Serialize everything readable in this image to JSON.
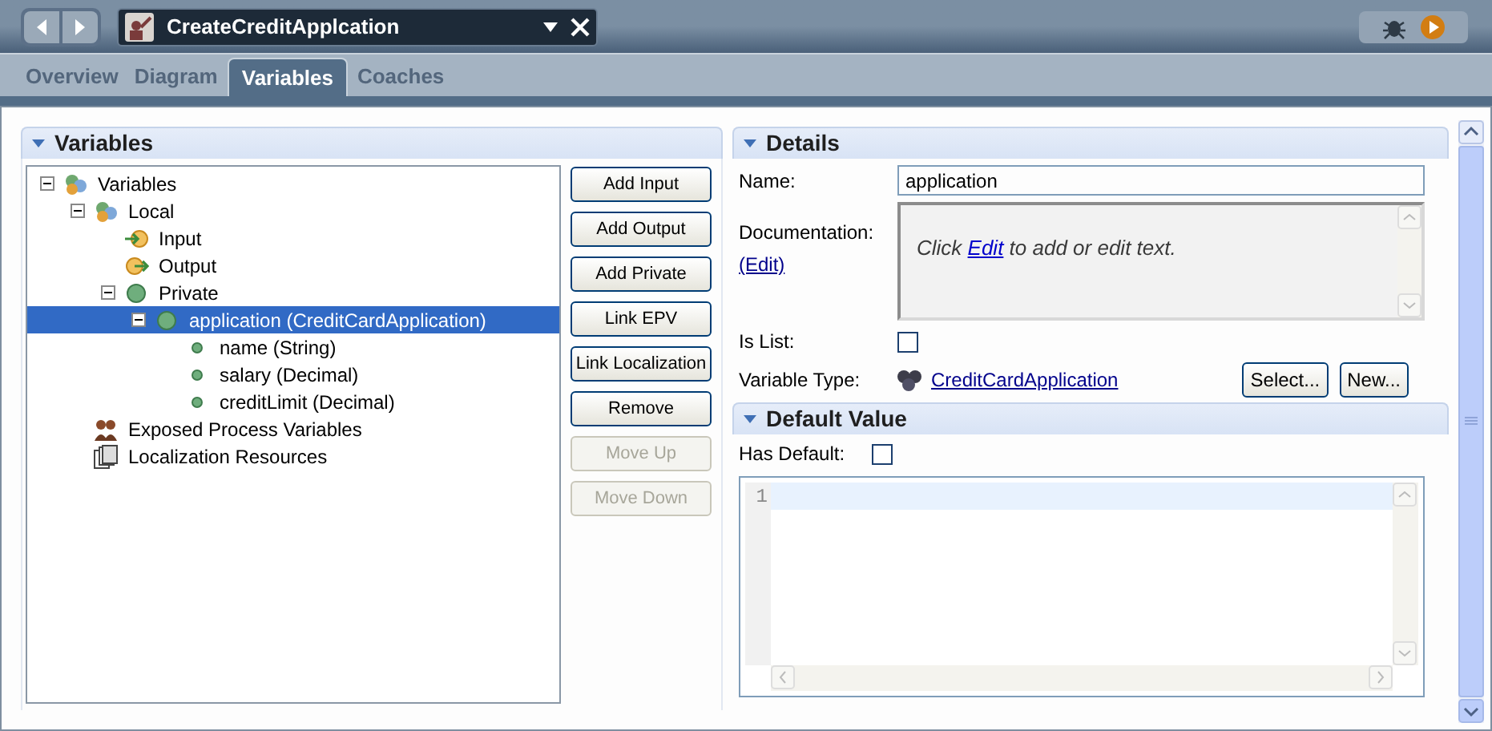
{
  "editor_tab": {
    "title": "CreateCreditApplcation"
  },
  "tabs": [
    {
      "label": "Overview",
      "selected": false
    },
    {
      "label": "Diagram",
      "selected": false
    },
    {
      "label": "Variables",
      "selected": true
    },
    {
      "label": "Coaches",
      "selected": false
    }
  ],
  "variables_panel": {
    "title": "Variables",
    "tree": [
      {
        "label": "Variables",
        "kind": "group",
        "expanded": true,
        "selected": false,
        "children": [
          {
            "label": "Local",
            "kind": "group",
            "expanded": true,
            "selected": false,
            "children": [
              {
                "label": "Input",
                "kind": "input",
                "selected": false
              },
              {
                "label": "Output",
                "kind": "output",
                "selected": false
              },
              {
                "label": "Private",
                "kind": "private",
                "expanded": true,
                "selected": false,
                "children": [
                  {
                    "label": "application (CreditCardApplication)",
                    "kind": "private",
                    "expanded": true,
                    "selected": true,
                    "children": [
                      {
                        "label": "name (String)",
                        "kind": "field",
                        "selected": false
                      },
                      {
                        "label": "salary (Decimal)",
                        "kind": "field",
                        "selected": false
                      },
                      {
                        "label": "creditLimit (Decimal)",
                        "kind": "field",
                        "selected": false
                      }
                    ]
                  }
                ]
              }
            ]
          },
          {
            "label": "Exposed Process Variables",
            "kind": "epv",
            "selected": false
          },
          {
            "label": "Localization Resources",
            "kind": "localization",
            "selected": false
          }
        ]
      }
    ],
    "buttons": [
      {
        "label": "Add Input",
        "disabled": false
      },
      {
        "label": "Add Output",
        "disabled": false
      },
      {
        "label": "Add Private",
        "disabled": false
      },
      {
        "label": "Link EPV",
        "disabled": false
      },
      {
        "label": "Link Localization",
        "disabled": false
      },
      {
        "label": "Remove",
        "disabled": false
      },
      {
        "label": "Move Up",
        "disabled": true
      },
      {
        "label": "Move Down",
        "disabled": true
      }
    ]
  },
  "details": {
    "title": "Details",
    "name_label": "Name:",
    "name_value": "application",
    "documentation_label": "Documentation:",
    "documentation_edit": "(Edit)",
    "documentation_hint": {
      "before": "Click",
      "link": "Edit",
      "after": "to add or edit text."
    },
    "is_list_label": "Is List:",
    "is_list_checked": false,
    "variable_type_label": "Variable Type:",
    "variable_type": "CreditCardApplication",
    "type_buttons": [
      "Select...",
      "New..."
    ]
  },
  "default_value": {
    "title": "Default Value",
    "has_default_label": "Has Default:",
    "has_default_checked": false,
    "line_numbers": [
      "1"
    ]
  }
}
